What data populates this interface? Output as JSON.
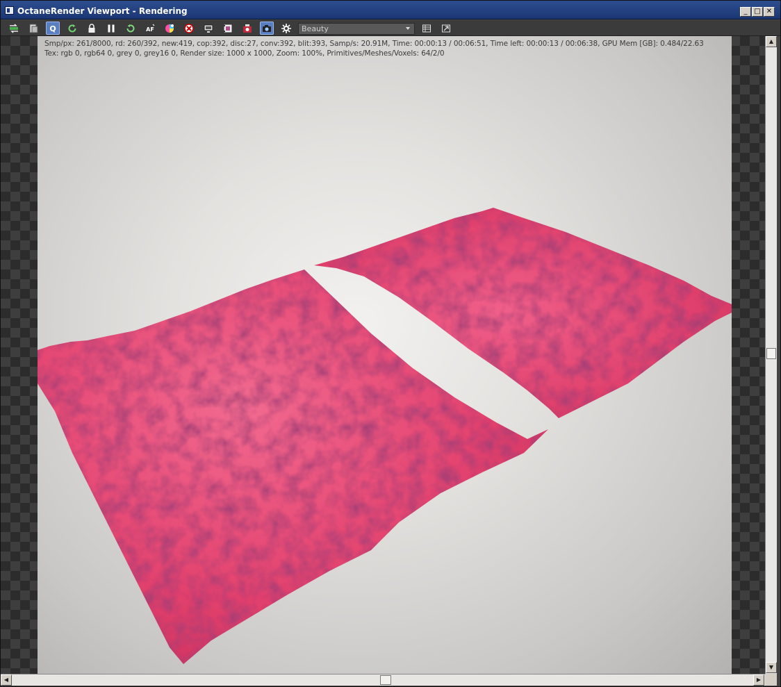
{
  "window": {
    "title": "OctaneRender Viewport - Rendering",
    "controls": {
      "minimize": "_",
      "maximize": "□",
      "close": "✕"
    }
  },
  "toolbar": {
    "buttons": [
      {
        "name": "send-scene-icon"
      },
      {
        "name": "clear-scene-icon"
      },
      {
        "name": "quick-render-icon",
        "label": "Q",
        "active": true
      },
      {
        "name": "restart-render-icon"
      },
      {
        "name": "lock-icon"
      },
      {
        "name": "pause-icon"
      },
      {
        "name": "refresh-icon"
      },
      {
        "name": "autofocus-icon",
        "label": "AF"
      },
      {
        "name": "color-picker-icon"
      },
      {
        "name": "region-render-icon"
      },
      {
        "name": "display-icon"
      },
      {
        "name": "film-icon"
      },
      {
        "name": "media-icon"
      },
      {
        "name": "camera-icon",
        "active": true
      },
      {
        "name": "settings-gear-icon"
      }
    ],
    "pass_select": {
      "value": "Beauty"
    },
    "right_buttons": [
      {
        "name": "table-icon"
      },
      {
        "name": "export-icon"
      }
    ]
  },
  "stats": {
    "line1": "Smp/px: 261/8000,   rd: 260/392,   new:419, cop:392, disc:27, conv:392, blit:393,   Samp/s: 20.91M,   Time: 00:00:13 / 00:06:51,   Time left: 00:00:13 / 00:06:38,   GPU Mem [GB]: 0.484/22.63",
    "line2": "Tex: rgb 0, rgb64 0, grey 0, grey16 0,   Render size: 1000 x 1000,   Zoom: 100%,   Primitives/Meshes/Voxels: 64/2/0"
  },
  "colors": {
    "mesh_base": "#e2426e",
    "mesh_light": "#f26a90",
    "mesh_dark": "#8e2148",
    "background": "#e3e2df"
  },
  "scrollbars": {
    "up_arrow": "▲",
    "down_arrow": "▼",
    "left_arrow": "◀",
    "right_arrow": "▶",
    "vertical_position": 0.5,
    "horizontal_position": 0.5
  }
}
